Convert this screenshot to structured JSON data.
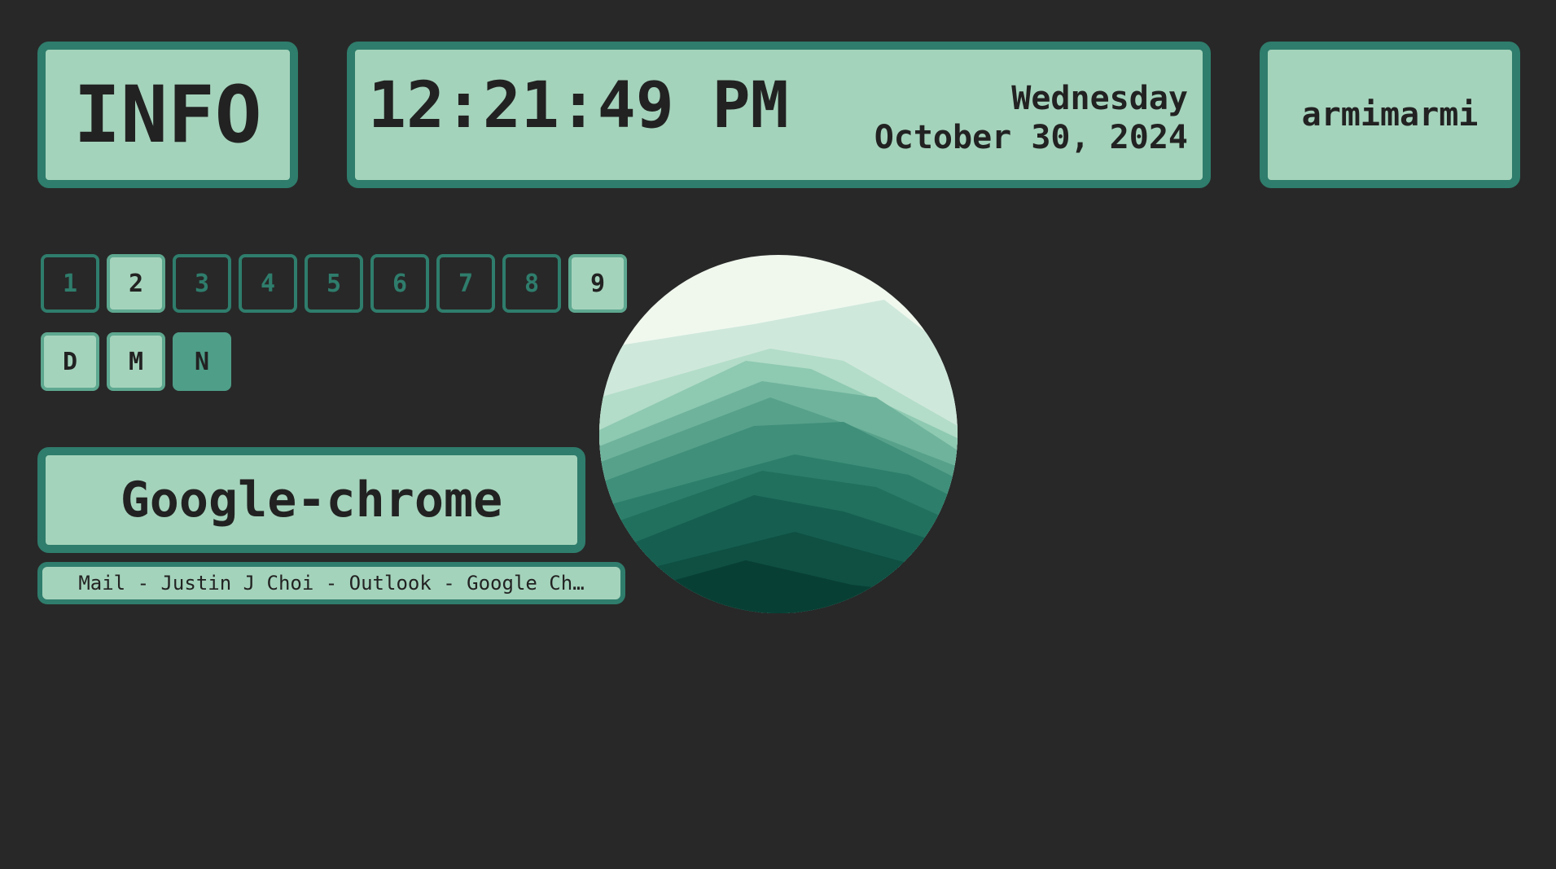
{
  "header": {
    "info_label": "INFO",
    "time": "12:21:49 PM",
    "weekday": "Wednesday",
    "date": "October 30, 2024",
    "username": "armimarmi"
  },
  "workspaces": [
    {
      "label": "1",
      "state": "inactive"
    },
    {
      "label": "2",
      "state": "active"
    },
    {
      "label": "3",
      "state": "inactive"
    },
    {
      "label": "4",
      "state": "inactive"
    },
    {
      "label": "5",
      "state": "inactive"
    },
    {
      "label": "6",
      "state": "inactive"
    },
    {
      "label": "7",
      "state": "inactive"
    },
    {
      "label": "8",
      "state": "inactive"
    },
    {
      "label": "9",
      "state": "active"
    }
  ],
  "modes": [
    {
      "label": "D",
      "state": "active"
    },
    {
      "label": "M",
      "state": "active"
    },
    {
      "label": "N",
      "state": "focused"
    }
  ],
  "window": {
    "app_name": "Google-chrome",
    "title": "Mail - Justin J Choi - Outlook - Google Ch…"
  },
  "colors": {
    "background": "#282828",
    "panel_fill": "#a4d3bb",
    "panel_border": "#2f7d6c",
    "focused_fill": "#4f9e88",
    "text": "#222222"
  },
  "avatar": {
    "icon": "mountain-layers-avatar-icon"
  }
}
